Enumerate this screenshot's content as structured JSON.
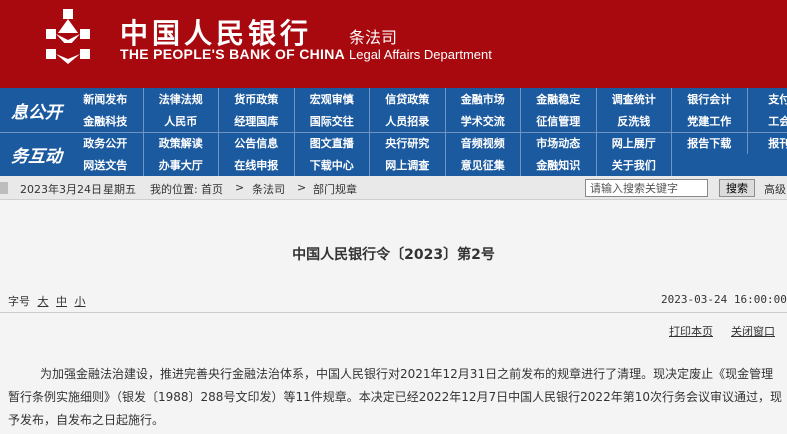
{
  "header": {
    "bank_name_zh": "中国人民银行",
    "bank_name_en": "THE PEOPLE'S BANK OF CHINA",
    "department_zh": "条法司",
    "department_en": "Legal Affairs Department",
    "colors": {
      "header_red": "#a8090e",
      "nav_blue": "#1c5a9f"
    }
  },
  "nav": {
    "section_1": "息公开",
    "section_2": "务互动",
    "rows": [
      [
        "新闻发布",
        "法律法规",
        "货币政策",
        "宏观审慎",
        "信贷政策",
        "金融市场",
        "金融稳定",
        "调查统计",
        "银行会计",
        "支付体"
      ],
      [
        "金融科技",
        "人民币",
        "经理国库",
        "国际交往",
        "人员招录",
        "学术交流",
        "征信管理",
        "反洗钱",
        "党建工作",
        "工会工"
      ],
      [
        "政务公开",
        "政策解读",
        "公告信息",
        "图文直播",
        "央行研究",
        "音频视频",
        "市场动态",
        "网上展厅",
        "报告下载",
        "报刊年"
      ],
      [
        "网送文告",
        "办事大厅",
        "在线申报",
        "下载中心",
        "网上调查",
        "意见征集",
        "金融知识",
        "关于我们"
      ]
    ]
  },
  "breadcrumb": {
    "date": "2023年3月24日",
    "weekday": "星期五",
    "location_label": "我的位置:",
    "home": "首页",
    "sep1": ">",
    "dept": "条法司",
    "sep2": ">",
    "section": "部门规章"
  },
  "search": {
    "placeholder": "请输入搜索关键字",
    "button": "搜索",
    "advanced": "高级"
  },
  "article": {
    "title": "中国人民银行令〔2023〕第2号",
    "font_size_label": "字号",
    "font_large": "大",
    "font_medium": "中",
    "font_small": "小",
    "datetime": "2023-03-24 16:00:00",
    "print": "打印本页",
    "close": "关闭窗口",
    "paragraph": "为加强金融法治建设，推进完善央行金融法治体系，中国人民银行对2021年12月31日之前发布的规章进行了清理。现决定废止《现金管理暂行条例实施细则》（银发〔1988〕288号文印发）等11件规章。本决定已经2022年12月7日中国人民银行2022年第10次行务会议审议通过，现予发布，自发布之日起施行。"
  }
}
